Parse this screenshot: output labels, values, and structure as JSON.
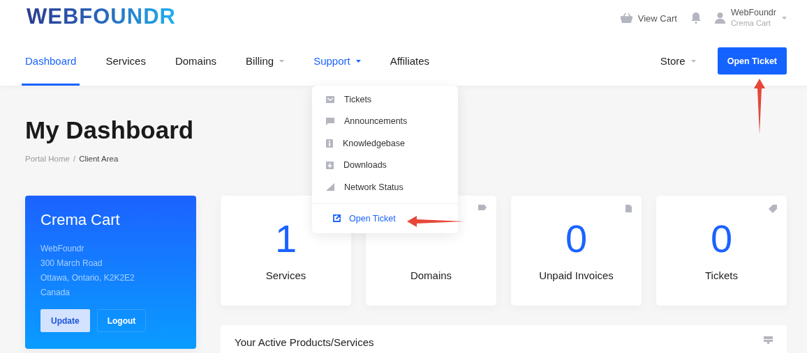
{
  "brand": {
    "logo": "WEBFOUNDR"
  },
  "top_bar": {
    "cart_label": "View Cart",
    "user": {
      "name": "WebFoundr",
      "company": "Crema Cart"
    }
  },
  "nav": {
    "items": [
      {
        "label": "Dashboard",
        "kind": "link",
        "selected": true,
        "expanded": false
      },
      {
        "label": "Services",
        "kind": "link",
        "selected": false,
        "expanded": false
      },
      {
        "label": "Domains",
        "kind": "link",
        "selected": false,
        "expanded": false
      },
      {
        "label": "Billing",
        "kind": "menu",
        "selected": false,
        "expanded": false
      },
      {
        "label": "Support",
        "kind": "menu",
        "selected": false,
        "expanded": true
      },
      {
        "label": "Affiliates",
        "kind": "link",
        "selected": false,
        "expanded": false
      }
    ],
    "right_items": [
      {
        "label": "Store",
        "kind": "menu",
        "selected": false,
        "expanded": false
      }
    ],
    "action_button": "Open Ticket"
  },
  "support_menu": {
    "items": [
      "Tickets",
      "Announcements",
      "Knowledgebase",
      "Downloads",
      "Network Status"
    ],
    "footer_link": "Open Ticket"
  },
  "page": {
    "title": "My Dashboard",
    "breadcrumb_separator": "/",
    "breadcrumb": [
      {
        "label": "Portal Home",
        "selected": false
      },
      {
        "label": "Client Area",
        "selected": true
      }
    ]
  },
  "client_card": {
    "name": "Crema Cart",
    "address_lines": [
      "WebFoundr",
      "300 March Road",
      "Ottawa, Ontario, K2K2E2",
      "Canada"
    ],
    "buttons": [
      "Update",
      "Logout"
    ]
  },
  "stats": [
    {
      "value": "1",
      "label": "Services"
    },
    {
      "label": "Domains"
    },
    {
      "value": "0",
      "label": "Unpaid Invoices"
    },
    {
      "value": "0",
      "label": "Tickets"
    }
  ],
  "products_panel": {
    "title": "Your Active Products/Services"
  }
}
